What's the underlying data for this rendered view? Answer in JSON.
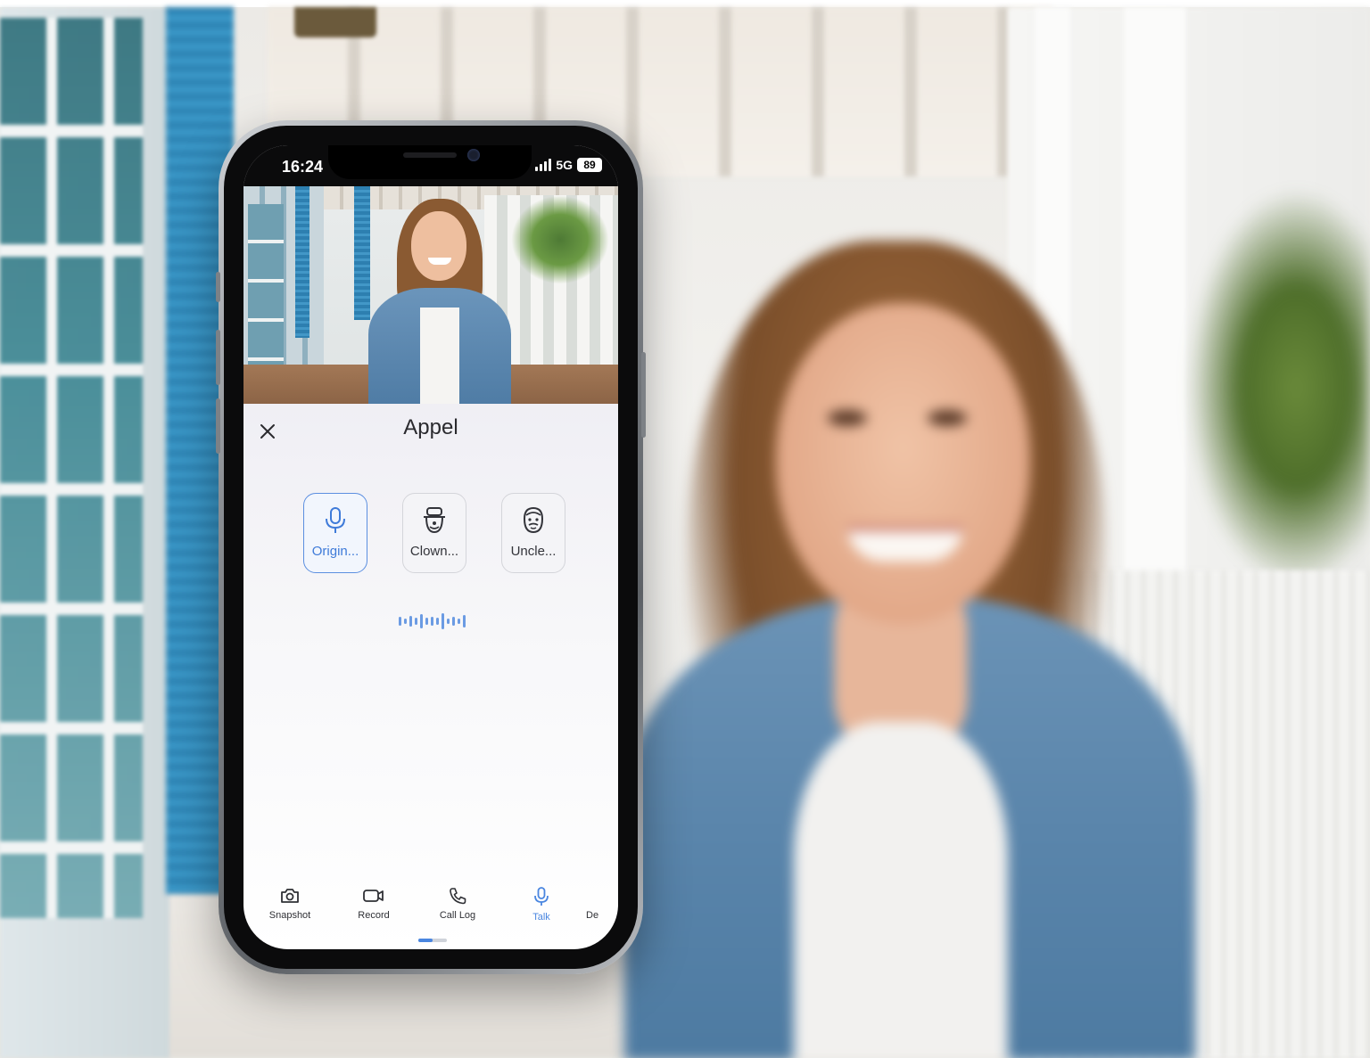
{
  "status_bar": {
    "time": "16:24",
    "network": "5G",
    "battery": "89"
  },
  "call": {
    "title": "Appel"
  },
  "voice_options": [
    {
      "label": "Origin...",
      "icon": "microphone-icon",
      "selected": true
    },
    {
      "label": "Clown...",
      "icon": "clown-face-icon",
      "selected": false
    },
    {
      "label": "Uncle...",
      "icon": "uncle-face-icon",
      "selected": false
    }
  ],
  "toolbar": {
    "items": [
      {
        "label": "Snapshot",
        "icon": "camera-icon",
        "active": false
      },
      {
        "label": "Record",
        "icon": "video-record-icon",
        "active": false
      },
      {
        "label": "Call Log",
        "icon": "phone-icon",
        "active": false
      },
      {
        "label": "Talk",
        "icon": "microphone-icon",
        "active": true
      },
      {
        "label": "De",
        "icon": "",
        "active": false
      }
    ]
  },
  "colors": {
    "accent": "#4a86e0",
    "text": "#2a2a2e"
  }
}
